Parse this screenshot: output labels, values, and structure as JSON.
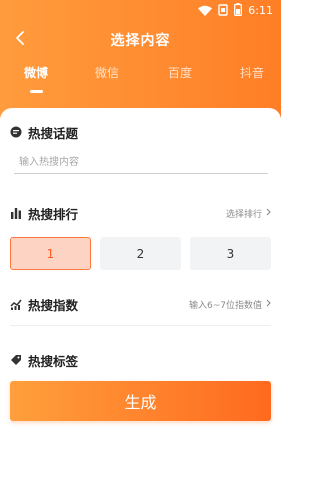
{
  "status_bar": {
    "time": "6:11",
    "icons": [
      "wifi-icon",
      "sim-icon",
      "battery-icon"
    ]
  },
  "header": {
    "title": "选择内容",
    "back_icon": "chevron-left-icon"
  },
  "tabs": [
    {
      "label": "微博",
      "active": true
    },
    {
      "label": "微信",
      "active": false
    },
    {
      "label": "百度",
      "active": false
    },
    {
      "label": "抖音",
      "active": false
    }
  ],
  "topic": {
    "title": "热搜话题",
    "icon": "chat-bubble-icon",
    "input_placeholder": "输入热搜内容",
    "input_value": ""
  },
  "ranking": {
    "title": "热搜排行",
    "icon": "bar-chart-icon",
    "link_label": "选择排行",
    "options": [
      "1",
      "2",
      "3"
    ],
    "selected": "1"
  },
  "index": {
    "title": "热搜指数",
    "icon": "trend-chart-icon",
    "hint": "输入6~7位指数值"
  },
  "tag": {
    "title": "热搜标签",
    "icon": "tag-icon"
  },
  "generate_button": "生成",
  "colors": {
    "accent": "#ff7e26",
    "selected_bg": "#fdd4c4",
    "selected_border": "#ff7a3c"
  }
}
